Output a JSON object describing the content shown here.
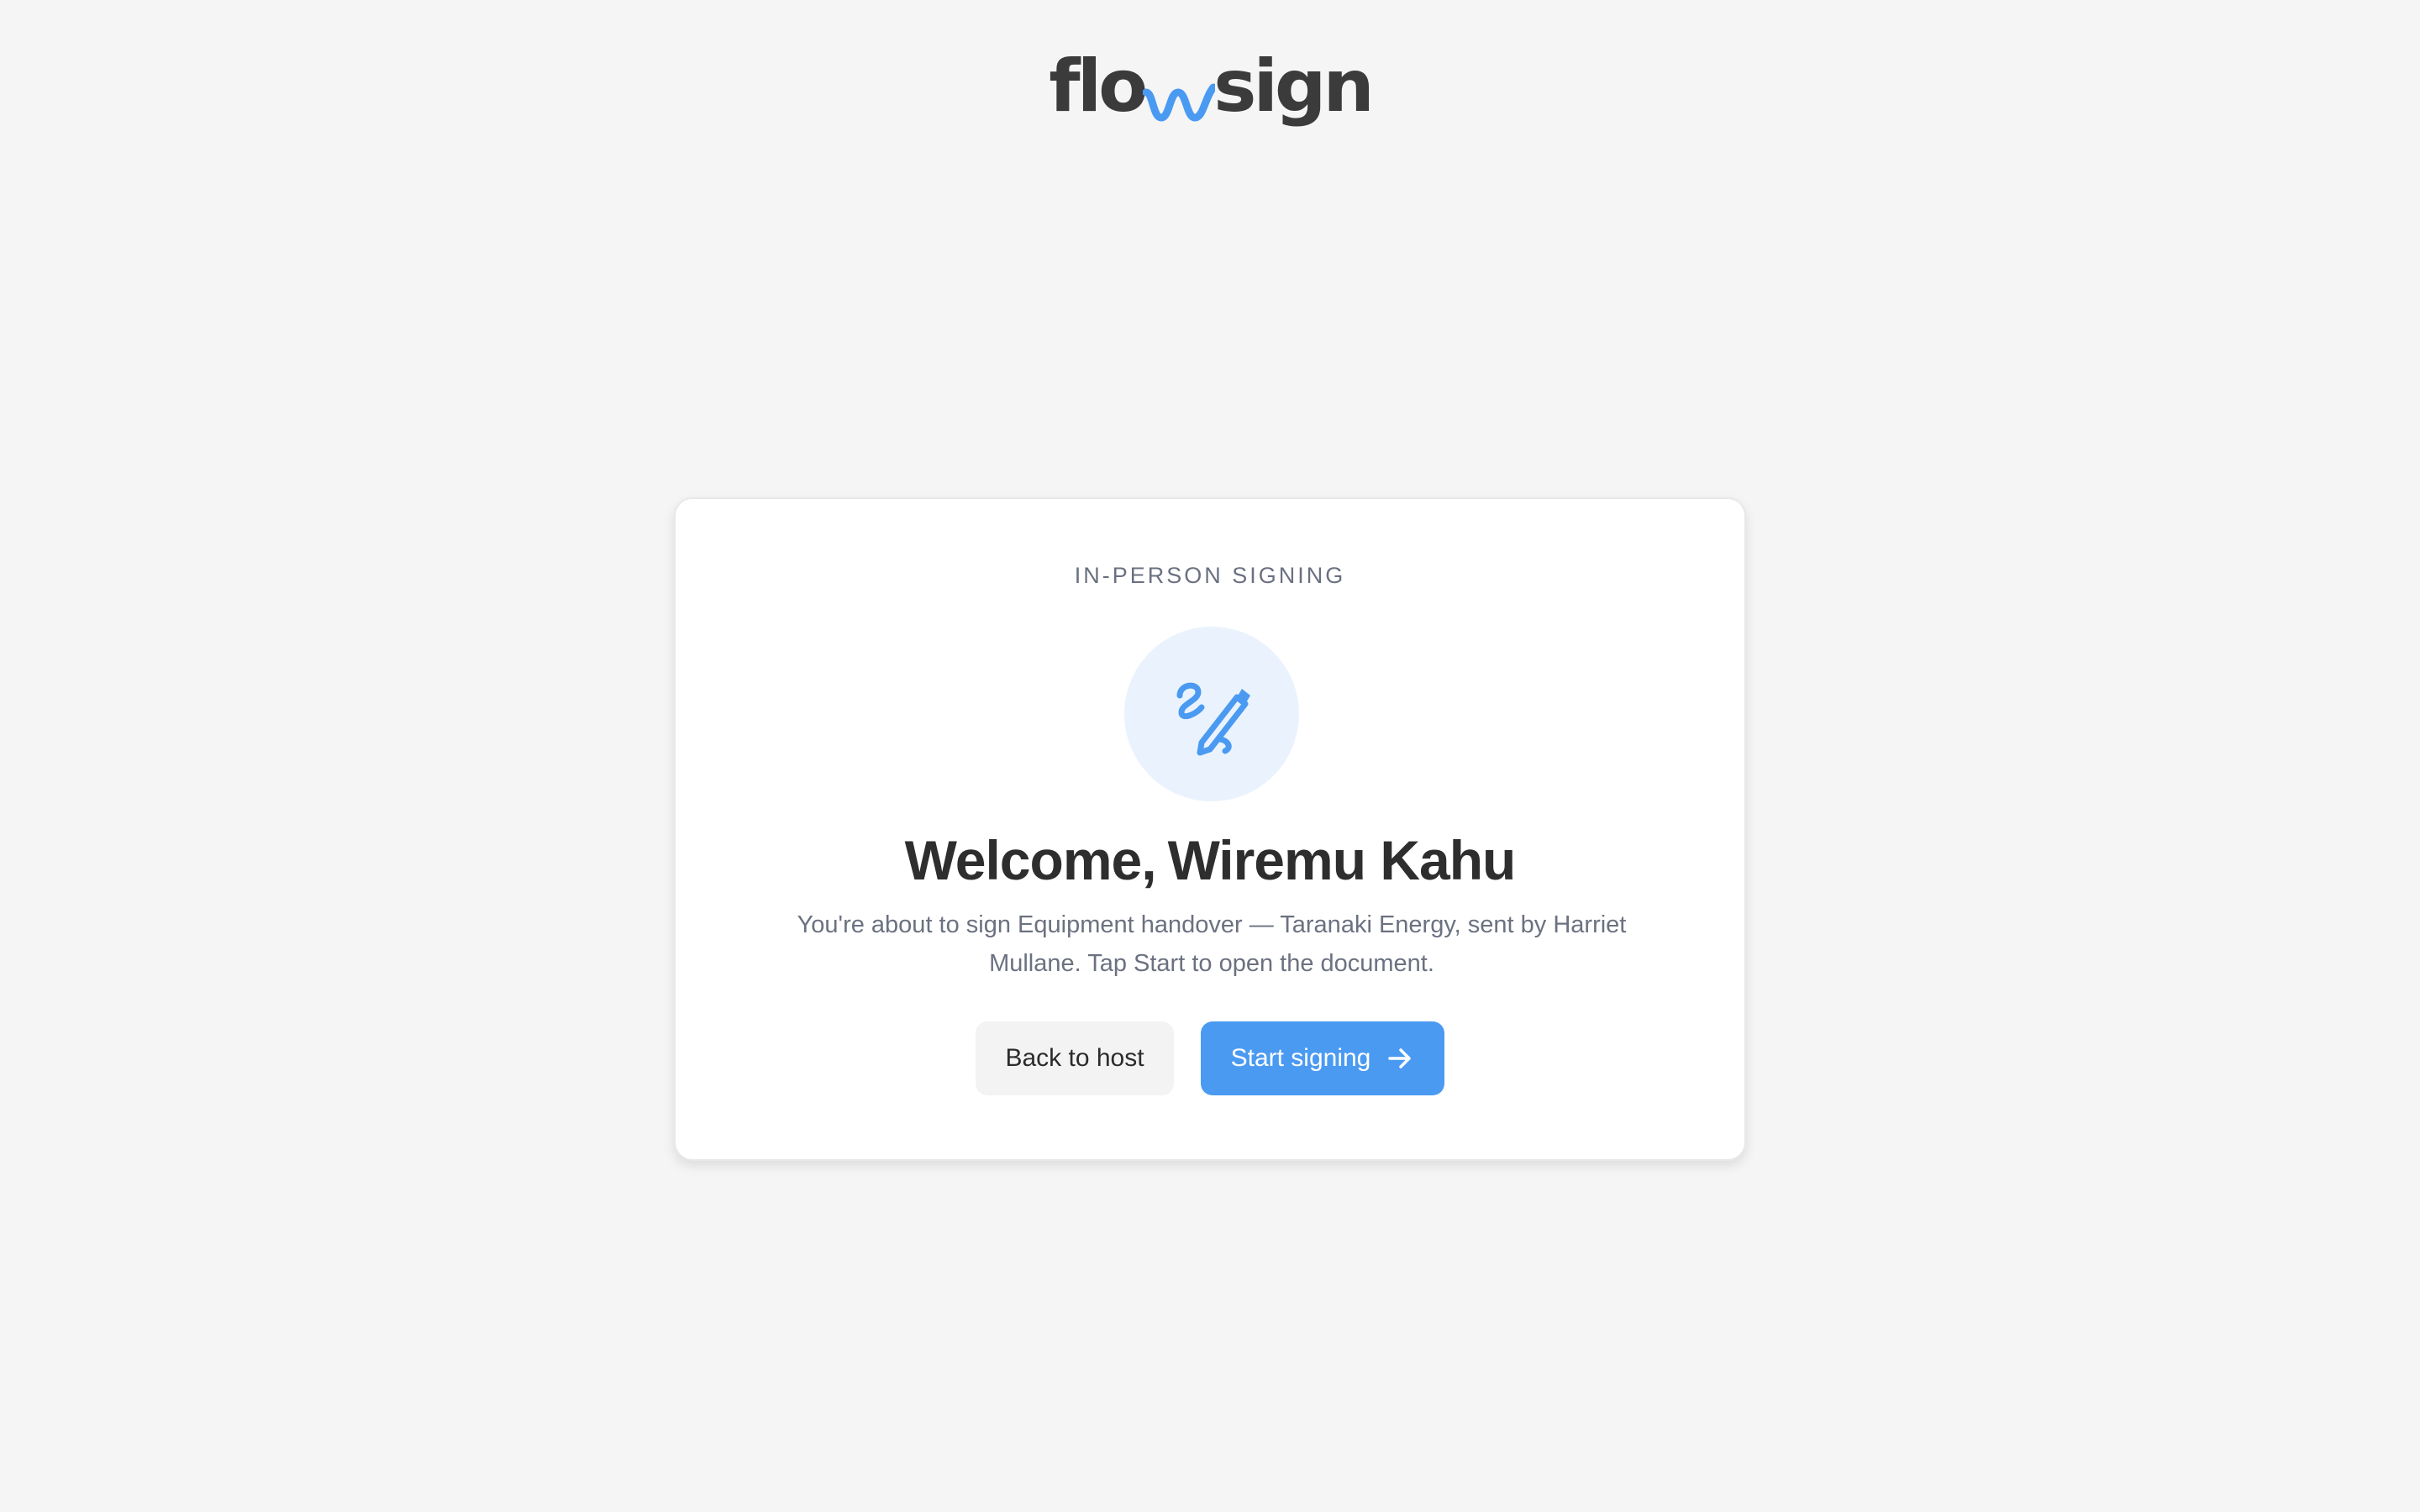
{
  "brand": {
    "name_left": "flo",
    "name_right": "sign",
    "accent_color": "#4a9af2",
    "mark_icon": "wave-w-icon"
  },
  "card": {
    "eyebrow": "IN-PERSON SIGNING",
    "icon": "signature-pen-icon",
    "greeting": "Welcome,",
    "signer_name": "Wiremu Kahu",
    "description": "You're about to sign Equipment handover — Taranaki Energy, sent by Harriet Mullane. Tap Start to open the document.",
    "back_label": "Back to host",
    "start_label": "Start signing",
    "start_icon": "arrow-right-icon"
  },
  "colors": {
    "background": "#f5f5f5",
    "primary": "#4a9af2",
    "icon_bg": "#eaf3fd"
  }
}
